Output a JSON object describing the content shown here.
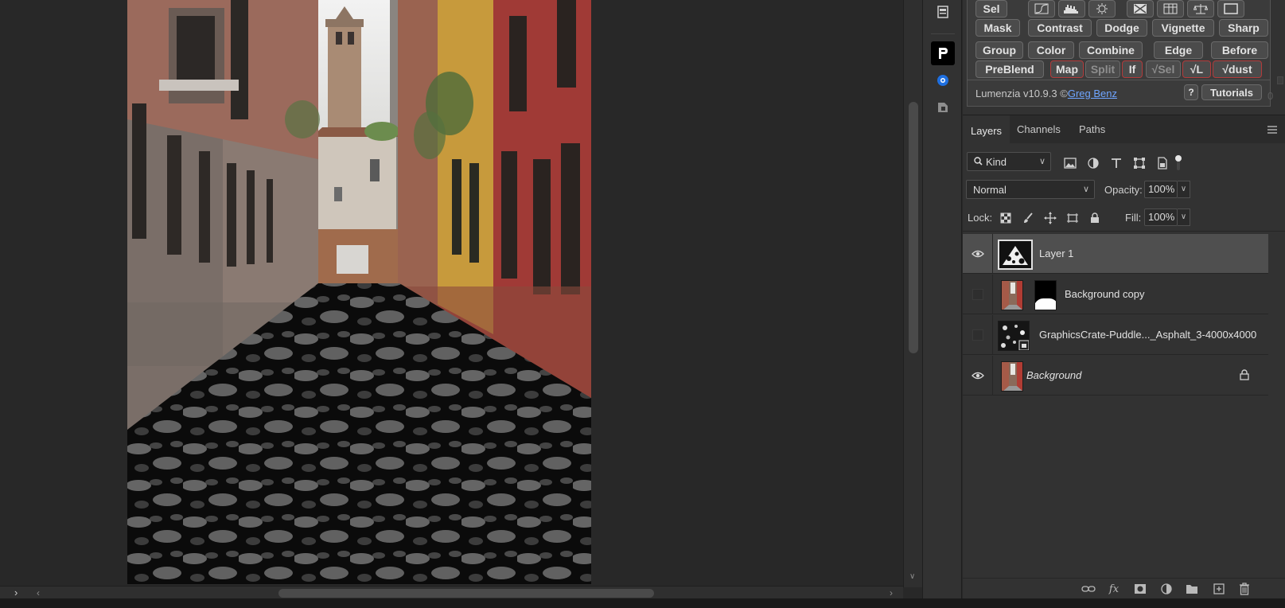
{
  "lumenzia": {
    "buttons_row1": [
      "Sel"
    ],
    "buttons_row2": [
      "Mask",
      "Contrast",
      "Dodge",
      "Vignette",
      "Sharp"
    ],
    "buttons_row3": [
      "Group",
      "Color",
      "Combine",
      "Edge",
      "Before"
    ],
    "buttons_row4": [
      "PreBlend",
      "Map",
      "Split",
      "If",
      "√Sel",
      "√L",
      "√dust"
    ],
    "version_text": "Lumenzia v10.9.3 ©",
    "author_link": "Greg Benz",
    "help_label": "?",
    "tutorials_label": "Tutorials",
    "scroll_value": "0"
  },
  "layers_panel": {
    "tabs": [
      "Layers",
      "Channels",
      "Paths"
    ],
    "active_tab": "Layers",
    "filter_kind": "Kind",
    "blend_mode": "Normal",
    "opacity_label": "Opacity:",
    "opacity_value": "100%",
    "lock_label": "Lock:",
    "fill_label": "Fill:",
    "fill_value": "100%",
    "layers": [
      {
        "name": "Layer 1",
        "visible": true,
        "selected": true,
        "italic": false,
        "locked": false
      },
      {
        "name": "Background copy",
        "visible": false,
        "selected": false,
        "italic": false,
        "locked": false,
        "has_mask": true
      },
      {
        "name": "GraphicsCrate-Puddle..._Asphalt_3-4000x4000",
        "visible": false,
        "selected": false,
        "italic": false,
        "locked": false,
        "smart_object": true
      },
      {
        "name": "Background",
        "visible": true,
        "selected": false,
        "italic": true,
        "locked": true
      }
    ]
  },
  "colors": {
    "panel_bg": "#323232",
    "canvas_bg": "#282828",
    "selected_layer": "#4f4f4f",
    "lumenzia_red": "#b33a3a",
    "link_blue": "#6fa5ff"
  }
}
